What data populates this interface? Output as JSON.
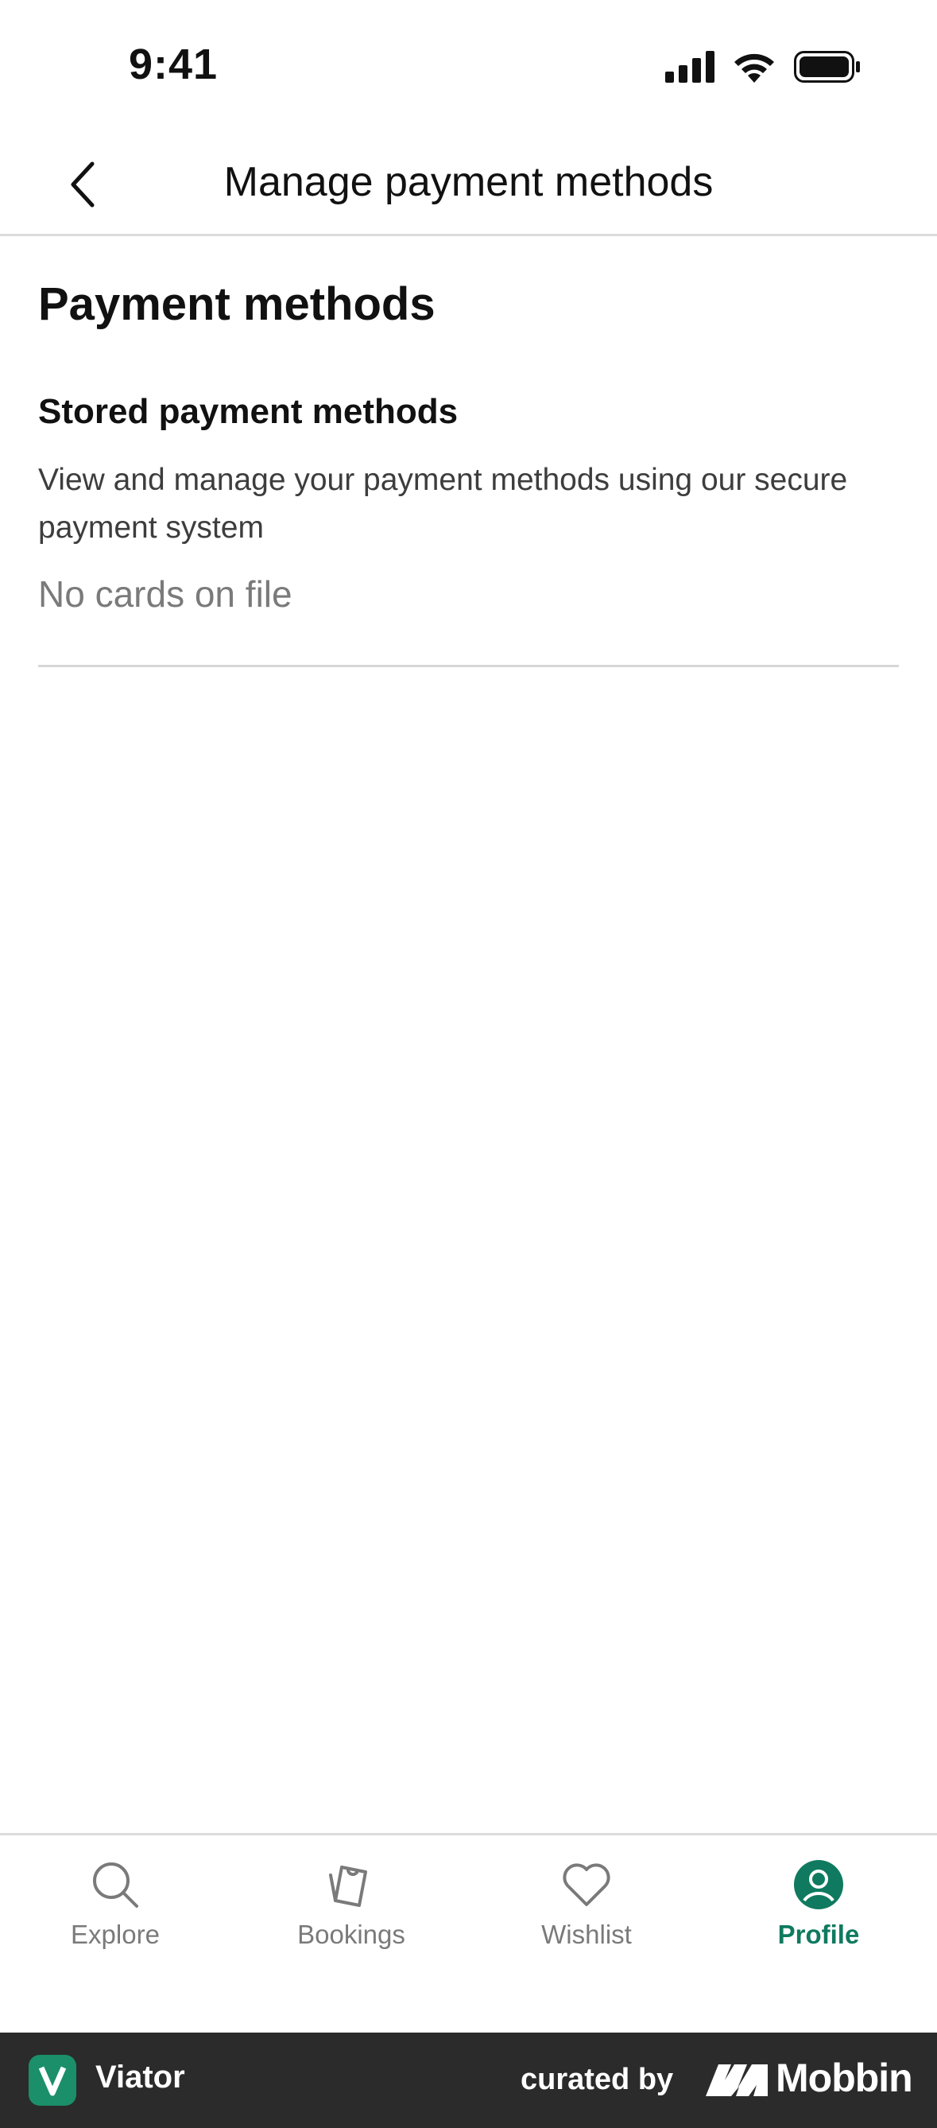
{
  "status_bar": {
    "time": "9:41"
  },
  "header": {
    "title": "Manage payment methods",
    "back_icon": "chevron-left-icon"
  },
  "main": {
    "section_title": "Payment methods",
    "subsection_title": "Stored payment methods",
    "description": "View and manage your payment methods using our secure payment system",
    "empty_state": "No cards on file"
  },
  "tab_bar": {
    "items": [
      {
        "label": "Explore",
        "icon": "search-icon",
        "active": false
      },
      {
        "label": "Bookings",
        "icon": "ticket-icon",
        "active": false
      },
      {
        "label": "Wishlist",
        "icon": "heart-icon",
        "active": false
      },
      {
        "label": "Profile",
        "icon": "profile-icon",
        "active": true
      }
    ],
    "active_color": "#0f7a5f",
    "inactive_color": "#7a7a7a"
  },
  "footer": {
    "app_name": "Viator",
    "curated_by": "curated by",
    "brand": "Mobbin",
    "brand_color": "#1a8f6a"
  }
}
